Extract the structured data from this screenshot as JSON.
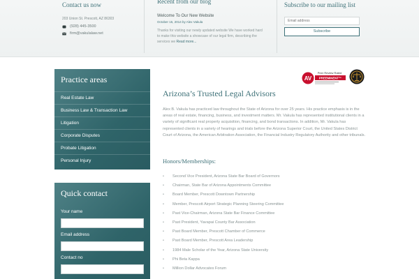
{
  "footer_top": {
    "contact": {
      "title": "Contact us now",
      "address": "203 Union St. Prescott, AZ 86303",
      "phone": "(928) 445-3500",
      "email": "firm@vakulalaw.net"
    },
    "blog": {
      "title": "Recent from our blog",
      "post_title": "Welcome To Our New Website",
      "post_meta": "October 15, 2014 by Alex Vakula",
      "excerpt": "Thanks for visiting our newly updated website We have worked hard to make this website a showcase of our legal firm, describing the services we",
      "read_more": "Read more..."
    },
    "mailing": {
      "title": "Subscribe to our mailing list",
      "email_placeholder": "Email address",
      "subscribe_label": "Subscribe"
    }
  },
  "sidebar": {
    "practice_title": "Practice areas",
    "practice_items": [
      "Real Estate Law",
      "Business Law & Transaction Law",
      "Litigation",
      "Corporate Disputes",
      "Probate Litigation",
      "Personal Injury"
    ],
    "quick_title": "Quick contact",
    "fields": [
      "Your name",
      "Email address",
      "Contact no"
    ]
  },
  "badges": {
    "peer_review_line": "Peer Review Rated",
    "av_letters": "AV",
    "preeminent": "PREEMINENT™",
    "colors": {
      "av_red": "#c8102e",
      "teal": "#3e7178"
    }
  },
  "main": {
    "title": "Arizona’s Trusted Legal Advisors",
    "intro": "Alex B. Vakula has practiced law throughout the State of Arizona for over 25 years. His practice emphasis is in the areas of real estate, financing, business, and investment matters. Mr. Vakula has represented institutional clients in a variety of significant real property acquisition, financing, and bond transactions. In addition, Mr. Vakula has represented clients in a variety of hearings and trials before the Arizona Superior Court, the United States District Court of Arizona, the American Arbitration Association, the Financial Industry Regulatory Authority and other tribunals.",
    "honors_title": "Honors/Memberships:",
    "honors": [
      "Second Vice President, Arizona State Bar Board of Governors",
      "Chairman, State Bar of Arizona Appointments Committee",
      "Board Member, Prescott Downtown Partnership",
      "Member, Prescott Airport Strategic Planning Steering Committee",
      "Past Vice-Chairman, Arizona State Bar Finance Committee",
      "Past President, Yavapai County Bar Association",
      "Past Board Member, Prescott Chamber of Commerce",
      "Past Board Member, Prescott Area Leadership",
      "1984 Male Scholar of the Year, Arizona State University",
      "Phi Beta Kappa",
      "Million Dollar Advocates Forum"
    ],
    "bullet": "•"
  }
}
